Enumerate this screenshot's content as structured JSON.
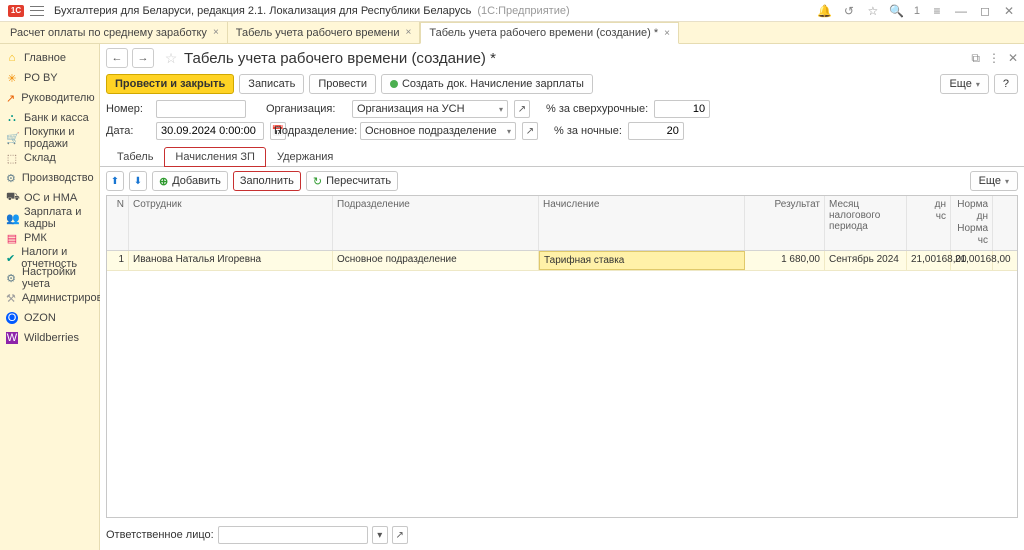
{
  "titlebar": {
    "title_main": "Бухгалтерия для Беларуси, редакция 2.1. Локализация для Республики Беларусь",
    "title_sub": "(1С:Предприятие)",
    "counter": "1"
  },
  "tabs": [
    {
      "label": "Расчет оплаты по среднему заработку",
      "active": false
    },
    {
      "label": "Табель учета рабочего времени",
      "active": false
    },
    {
      "label": "Табель учета рабочего времени (создание) *",
      "active": true
    }
  ],
  "sidebar": [
    {
      "icon": "c-home",
      "glyph": "⌂",
      "label": "Главное"
    },
    {
      "icon": "c-asterisk",
      "glyph": "✳",
      "label": "PO BY"
    },
    {
      "icon": "c-chart",
      "glyph": "↗",
      "label": "Руководителю"
    },
    {
      "icon": "c-bank",
      "glyph": "⛬",
      "label": "Банк и касса"
    },
    {
      "icon": "c-cart",
      "glyph": "🛒",
      "label": "Покупки и продажи"
    },
    {
      "icon": "c-box",
      "glyph": "⬚",
      "label": "Склад"
    },
    {
      "icon": "c-gear",
      "glyph": "⚙",
      "label": "Производство"
    },
    {
      "icon": "c-truck",
      "glyph": "⛟",
      "label": "ОС и НМА"
    },
    {
      "icon": "c-people",
      "glyph": "👥",
      "label": "Зарплата и кадры"
    },
    {
      "icon": "c-pmk",
      "glyph": "▤",
      "label": "РМК"
    },
    {
      "icon": "c-tax",
      "glyph": "✔",
      "label": "Налоги и отчетность"
    },
    {
      "icon": "c-cog",
      "glyph": "⚙",
      "label": "Настройки учета"
    },
    {
      "icon": "c-adm",
      "glyph": "⚒",
      "label": "Администрирование"
    },
    {
      "icon": "c-ozon",
      "glyph": "O",
      "label": "OZON"
    },
    {
      "icon": "c-wb",
      "glyph": "W",
      "label": "Wildberries"
    }
  ],
  "heading": {
    "title": "Табель учета рабочего времени (создание) *"
  },
  "actions": {
    "primary": "Провести и закрыть",
    "save": "Записать",
    "post": "Провести",
    "create": "Создать док. Начисление зарплаты",
    "more": "Еще",
    "help": "?"
  },
  "form": {
    "number_label": "Номер:",
    "number_value": "",
    "date_label": "Дата:",
    "date_value": "30.09.2024 0:00:00",
    "org_label": "Организация:",
    "org_value": "Организация на УСН",
    "dep_label": "Подразделение:",
    "dep_value": "Основное подразделение",
    "overtime_label": "% за сверхурочные:",
    "overtime_value": "10",
    "night_label": "% за ночные:",
    "night_value": "20"
  },
  "inner_tabs": [
    {
      "label": "Табель",
      "active": false,
      "highlight": false
    },
    {
      "label": "Начисления ЗП",
      "active": true,
      "highlight": true
    },
    {
      "label": "Удержания",
      "active": false,
      "highlight": false
    }
  ],
  "toolbar2": {
    "add": "Добавить",
    "fill": "Заполнить",
    "recalc": "Пересчитать",
    "more": "Еще"
  },
  "grid": {
    "headers": {
      "n": "N",
      "employee": "Сотрудник",
      "department": "Подразделение",
      "accrual": "Начисление",
      "result": "Результат",
      "period": "Месяц налогового периода",
      "days": "дн",
      "hours": "чс",
      "norm_days": "Норма дн",
      "norm_hours": "Норма чс"
    },
    "rows": [
      {
        "n": "1",
        "employee": "Иванова Наталья Игоревна",
        "department": "Основное подразделение",
        "accrual": "Тарифная ставка",
        "result": "1 680,00",
        "period": "Сентябрь 2024",
        "days": "21,00",
        "hours": "168,00",
        "norm_days": "21,00",
        "norm_hours": "168,00"
      }
    ]
  },
  "footer": {
    "resp_label": "Ответственное лицо:"
  }
}
